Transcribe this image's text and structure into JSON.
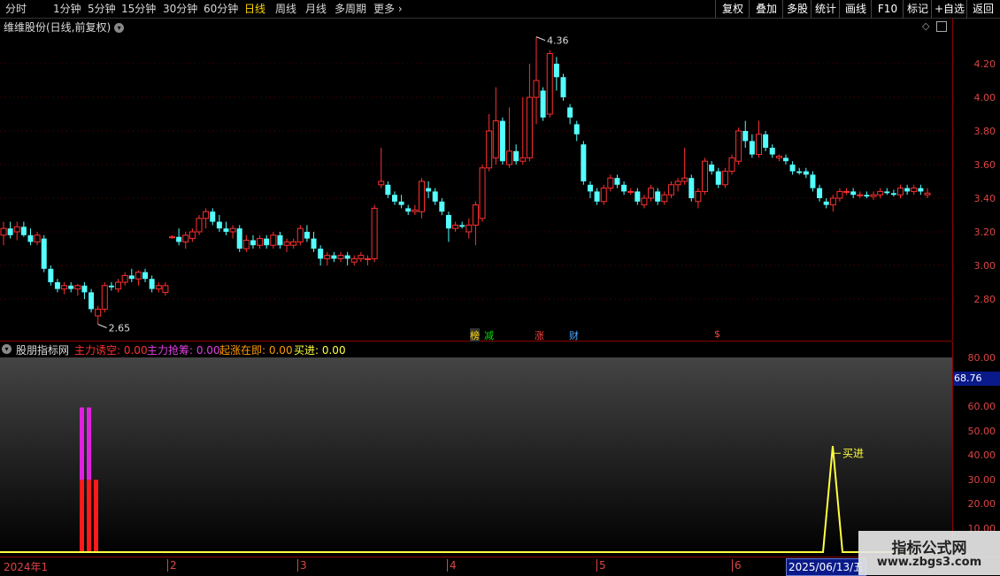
{
  "toolbar": {
    "periods": [
      "分时",
      "1分钟",
      "5分钟",
      "15分钟",
      "30分钟",
      "60分钟",
      "日线",
      "周线",
      "月线",
      "多周期",
      "更多"
    ],
    "active_period": "日线",
    "actions": [
      "复权",
      "叠加",
      "多股",
      "统计",
      "画线",
      "F10",
      "标记",
      "+自选",
      "返回"
    ]
  },
  "main": {
    "title": "维维股份(日线,前复权)",
    "y_labels": [
      "4.20",
      "4.00",
      "3.80",
      "3.60",
      "3.40",
      "3.20",
      "3.00",
      "2.80"
    ],
    "high_label": "4.36",
    "low_label": "2.65",
    "event_tags": [
      {
        "text": "榜",
        "color": "#ffd700"
      },
      {
        "text": "减",
        "color": "#00e000"
      },
      {
        "text": "涨",
        "color": "#ff4040"
      },
      {
        "text": "财",
        "color": "#4fa8ff"
      },
      {
        "text": "$",
        "color": "#ff4040"
      }
    ]
  },
  "indicator": {
    "name": "股朋指标网",
    "lines": [
      {
        "label": "主力诱空: 0.00",
        "color": "#ff3030"
      },
      {
        "label": "主力抢筹: 0.00",
        "color": "#e040e0"
      },
      {
        "label": "起涨在即: 0.00",
        "color": "#ff9a00"
      },
      {
        "label": "买进: 0.00",
        "color": "#ffff40"
      }
    ],
    "y_labels": [
      "80.00",
      "60.00",
      "50.00",
      "40.00",
      "30.00",
      "20.00",
      "10.00"
    ],
    "cursor_value": "68.76",
    "buy_label": "买进"
  },
  "dates": {
    "labels": [
      "2024年1",
      "2",
      "3",
      "4",
      "5",
      "6"
    ],
    "cursor_date": "2025/06/13/五"
  },
  "watermark": {
    "line1": "指标公式网",
    "line2": "www.zbgs3.com"
  },
  "colors": {
    "up": "#ff3030",
    "down": "#54ffff",
    "axis": "#d44",
    "grid": "#8b0000"
  },
  "chart_data": {
    "type": "candlestick",
    "ylim": [
      2.7,
      4.4
    ],
    "candles": [
      {
        "o": 3.18,
        "h": 3.26,
        "l": 3.12,
        "c": 3.22
      },
      {
        "o": 3.22,
        "h": 3.26,
        "l": 3.16,
        "c": 3.18
      },
      {
        "o": 3.2,
        "h": 3.26,
        "l": 3.15,
        "c": 3.23
      },
      {
        "o": 3.23,
        "h": 3.26,
        "l": 3.17,
        "c": 3.18
      },
      {
        "o": 3.18,
        "h": 3.22,
        "l": 3.12,
        "c": 3.14
      },
      {
        "o": 3.14,
        "h": 3.2,
        "l": 3.12,
        "c": 3.18
      },
      {
        "o": 3.16,
        "h": 3.18,
        "l": 2.96,
        "c": 2.98
      },
      {
        "o": 2.98,
        "h": 3.0,
        "l": 2.88,
        "c": 2.9
      },
      {
        "o": 2.9,
        "h": 2.92,
        "l": 2.84,
        "c": 2.86
      },
      {
        "o": 2.86,
        "h": 2.9,
        "l": 2.83,
        "c": 2.88
      },
      {
        "o": 2.88,
        "h": 2.9,
        "l": 2.84,
        "c": 2.86
      },
      {
        "o": 2.86,
        "h": 2.89,
        "l": 2.82,
        "c": 2.88
      },
      {
        "o": 2.88,
        "h": 2.9,
        "l": 2.8,
        "c": 2.84
      },
      {
        "o": 2.84,
        "h": 2.86,
        "l": 2.72,
        "c": 2.74
      },
      {
        "o": 2.7,
        "h": 2.76,
        "l": 2.65,
        "c": 2.74
      },
      {
        "o": 2.74,
        "h": 2.9,
        "l": 2.72,
        "c": 2.88
      },
      {
        "o": 2.88,
        "h": 2.9,
        "l": 2.85,
        "c": 2.87
      },
      {
        "o": 2.86,
        "h": 2.92,
        "l": 2.84,
        "c": 2.9
      },
      {
        "o": 2.9,
        "h": 2.96,
        "l": 2.88,
        "c": 2.94
      },
      {
        "o": 2.94,
        "h": 2.98,
        "l": 2.9,
        "c": 2.92
      },
      {
        "o": 2.92,
        "h": 2.97,
        "l": 2.88,
        "c": 2.96
      },
      {
        "o": 2.96,
        "h": 2.98,
        "l": 2.9,
        "c": 2.92
      },
      {
        "o": 2.92,
        "h": 2.94,
        "l": 2.84,
        "c": 2.86
      },
      {
        "o": 2.86,
        "h": 2.9,
        "l": 2.84,
        "c": 2.88
      },
      {
        "o": 2.84,
        "h": 2.9,
        "l": 2.82,
        "c": 2.88
      },
      {
        "o": 3.17,
        "h": 3.18,
        "l": 3.16,
        "c": 3.17
      },
      {
        "o": 3.17,
        "h": 3.22,
        "l": 3.12,
        "c": 3.14
      },
      {
        "o": 3.14,
        "h": 3.2,
        "l": 3.1,
        "c": 3.18
      },
      {
        "o": 3.16,
        "h": 3.22,
        "l": 3.14,
        "c": 3.2
      },
      {
        "o": 3.2,
        "h": 3.3,
        "l": 3.18,
        "c": 3.28
      },
      {
        "o": 3.28,
        "h": 3.34,
        "l": 3.22,
        "c": 3.32
      },
      {
        "o": 3.32,
        "h": 3.34,
        "l": 3.24,
        "c": 3.26
      },
      {
        "o": 3.26,
        "h": 3.3,
        "l": 3.2,
        "c": 3.22
      },
      {
        "o": 3.22,
        "h": 3.26,
        "l": 3.18,
        "c": 3.2
      },
      {
        "o": 3.2,
        "h": 3.24,
        "l": 3.16,
        "c": 3.22
      },
      {
        "o": 3.22,
        "h": 3.24,
        "l": 3.08,
        "c": 3.1
      },
      {
        "o": 3.1,
        "h": 3.18,
        "l": 3.08,
        "c": 3.15
      },
      {
        "o": 3.15,
        "h": 3.18,
        "l": 3.1,
        "c": 3.12
      },
      {
        "o": 3.12,
        "h": 3.18,
        "l": 3.1,
        "c": 3.16
      },
      {
        "o": 3.16,
        "h": 3.18,
        "l": 3.1,
        "c": 3.12
      },
      {
        "o": 3.12,
        "h": 3.2,
        "l": 3.1,
        "c": 3.18
      },
      {
        "o": 3.18,
        "h": 3.2,
        "l": 3.1,
        "c": 3.12
      },
      {
        "o": 3.12,
        "h": 3.16,
        "l": 3.08,
        "c": 3.14
      },
      {
        "o": 3.12,
        "h": 3.16,
        "l": 3.1,
        "c": 3.14
      },
      {
        "o": 3.14,
        "h": 3.24,
        "l": 3.12,
        "c": 3.22
      },
      {
        "o": 3.2,
        "h": 3.24,
        "l": 3.14,
        "c": 3.16
      },
      {
        "o": 3.16,
        "h": 3.2,
        "l": 3.08,
        "c": 3.1
      },
      {
        "o": 3.1,
        "h": 3.12,
        "l": 3.0,
        "c": 3.04
      },
      {
        "o": 3.04,
        "h": 3.08,
        "l": 3.0,
        "c": 3.06
      },
      {
        "o": 3.06,
        "h": 3.08,
        "l": 3.02,
        "c": 3.04
      },
      {
        "o": 3.04,
        "h": 3.08,
        "l": 3.02,
        "c": 3.06
      },
      {
        "o": 3.06,
        "h": 3.08,
        "l": 3.0,
        "c": 3.04
      },
      {
        "o": 3.02,
        "h": 3.06,
        "l": 3.0,
        "c": 3.04
      },
      {
        "o": 3.04,
        "h": 3.08,
        "l": 3.02,
        "c": 3.06
      },
      {
        "o": 3.04,
        "h": 3.06,
        "l": 3.0,
        "c": 3.04
      },
      {
        "o": 3.04,
        "h": 3.36,
        "l": 3.02,
        "c": 3.34
      },
      {
        "o": 3.48,
        "h": 3.7,
        "l": 3.46,
        "c": 3.5
      },
      {
        "o": 3.48,
        "h": 3.5,
        "l": 3.4,
        "c": 3.42
      },
      {
        "o": 3.42,
        "h": 3.44,
        "l": 3.36,
        "c": 3.38
      },
      {
        "o": 3.38,
        "h": 3.42,
        "l": 3.34,
        "c": 3.36
      },
      {
        "o": 3.34,
        "h": 3.36,
        "l": 3.3,
        "c": 3.32
      },
      {
        "o": 3.32,
        "h": 3.36,
        "l": 3.3,
        "c": 3.33
      },
      {
        "o": 3.32,
        "h": 3.52,
        "l": 3.28,
        "c": 3.5
      },
      {
        "o": 3.46,
        "h": 3.5,
        "l": 3.4,
        "c": 3.44
      },
      {
        "o": 3.44,
        "h": 3.46,
        "l": 3.36,
        "c": 3.38
      },
      {
        "o": 3.38,
        "h": 3.4,
        "l": 3.3,
        "c": 3.32
      },
      {
        "o": 3.3,
        "h": 3.32,
        "l": 3.14,
        "c": 3.22
      },
      {
        "o": 3.22,
        "h": 3.26,
        "l": 3.2,
        "c": 3.24
      },
      {
        "o": 3.24,
        "h": 3.26,
        "l": 3.22,
        "c": 3.23
      },
      {
        "o": 3.2,
        "h": 3.28,
        "l": 3.16,
        "c": 3.24
      },
      {
        "o": 3.24,
        "h": 3.38,
        "l": 3.12,
        "c": 3.36
      },
      {
        "o": 3.28,
        "h": 3.6,
        "l": 3.26,
        "c": 3.58
      },
      {
        "o": 3.58,
        "h": 3.9,
        "l": 3.56,
        "c": 3.8
      },
      {
        "o": 3.64,
        "h": 4.06,
        "l": 3.6,
        "c": 3.86
      },
      {
        "o": 3.86,
        "h": 3.88,
        "l": 3.6,
        "c": 3.62
      },
      {
        "o": 3.6,
        "h": 3.94,
        "l": 3.58,
        "c": 3.68
      },
      {
        "o": 3.68,
        "h": 3.72,
        "l": 3.6,
        "c": 3.62
      },
      {
        "o": 3.62,
        "h": 4.0,
        "l": 3.6,
        "c": 3.64
      },
      {
        "o": 3.64,
        "h": 4.2,
        "l": 3.62,
        "c": 4.0
      },
      {
        "o": 4.0,
        "h": 4.36,
        "l": 3.84,
        "c": 4.1
      },
      {
        "o": 4.04,
        "h": 4.06,
        "l": 3.86,
        "c": 3.88
      },
      {
        "o": 3.9,
        "h": 4.28,
        "l": 3.88,
        "c": 4.26
      },
      {
        "o": 4.2,
        "h": 4.24,
        "l": 4.04,
        "c": 4.12
      },
      {
        "o": 4.12,
        "h": 4.14,
        "l": 3.98,
        "c": 4.0
      },
      {
        "o": 3.94,
        "h": 3.96,
        "l": 3.84,
        "c": 3.88
      },
      {
        "o": 3.84,
        "h": 3.86,
        "l": 3.74,
        "c": 3.78
      },
      {
        "o": 3.72,
        "h": 3.74,
        "l": 3.48,
        "c": 3.5
      },
      {
        "o": 3.48,
        "h": 3.5,
        "l": 3.4,
        "c": 3.44
      },
      {
        "o": 3.44,
        "h": 3.46,
        "l": 3.36,
        "c": 3.38
      },
      {
        "o": 3.38,
        "h": 3.48,
        "l": 3.36,
        "c": 3.46
      },
      {
        "o": 3.46,
        "h": 3.54,
        "l": 3.44,
        "c": 3.52
      },
      {
        "o": 3.52,
        "h": 3.54,
        "l": 3.46,
        "c": 3.48
      },
      {
        "o": 3.48,
        "h": 3.5,
        "l": 3.42,
        "c": 3.44
      },
      {
        "o": 3.44,
        "h": 3.46,
        "l": 3.42,
        "c": 3.44
      },
      {
        "o": 3.44,
        "h": 3.46,
        "l": 3.36,
        "c": 3.38
      },
      {
        "o": 3.36,
        "h": 3.42,
        "l": 3.34,
        "c": 3.4
      },
      {
        "o": 3.4,
        "h": 3.48,
        "l": 3.38,
        "c": 3.46
      },
      {
        "o": 3.44,
        "h": 3.46,
        "l": 3.36,
        "c": 3.38
      },
      {
        "o": 3.38,
        "h": 3.44,
        "l": 3.36,
        "c": 3.42
      },
      {
        "o": 3.42,
        "h": 3.5,
        "l": 3.4,
        "c": 3.48
      },
      {
        "o": 3.48,
        "h": 3.52,
        "l": 3.44,
        "c": 3.5
      },
      {
        "o": 3.5,
        "h": 3.7,
        "l": 3.48,
        "c": 3.52
      },
      {
        "o": 3.52,
        "h": 3.54,
        "l": 3.38,
        "c": 3.4
      },
      {
        "o": 3.38,
        "h": 3.46,
        "l": 3.34,
        "c": 3.44
      },
      {
        "o": 3.44,
        "h": 3.64,
        "l": 3.42,
        "c": 3.62
      },
      {
        "o": 3.6,
        "h": 3.62,
        "l": 3.54,
        "c": 3.56
      },
      {
        "o": 3.56,
        "h": 3.58,
        "l": 3.46,
        "c": 3.48
      },
      {
        "o": 3.48,
        "h": 3.58,
        "l": 3.46,
        "c": 3.56
      },
      {
        "o": 3.56,
        "h": 3.66,
        "l": 3.54,
        "c": 3.64
      },
      {
        "o": 3.62,
        "h": 3.82,
        "l": 3.6,
        "c": 3.8
      },
      {
        "o": 3.8,
        "h": 3.86,
        "l": 3.7,
        "c": 3.74
      },
      {
        "o": 3.74,
        "h": 3.78,
        "l": 3.64,
        "c": 3.66
      },
      {
        "o": 3.66,
        "h": 3.86,
        "l": 3.64,
        "c": 3.78
      },
      {
        "o": 3.78,
        "h": 3.8,
        "l": 3.68,
        "c": 3.7
      },
      {
        "o": 3.7,
        "h": 3.72,
        "l": 3.64,
        "c": 3.66
      },
      {
        "o": 3.64,
        "h": 3.66,
        "l": 3.62,
        "c": 3.65
      },
      {
        "o": 3.64,
        "h": 3.66,
        "l": 3.6,
        "c": 3.62
      },
      {
        "o": 3.6,
        "h": 3.62,
        "l": 3.54,
        "c": 3.56
      },
      {
        "o": 3.56,
        "h": 3.58,
        "l": 3.54,
        "c": 3.55
      },
      {
        "o": 3.56,
        "h": 3.58,
        "l": 3.52,
        "c": 3.54
      },
      {
        "o": 3.54,
        "h": 3.56,
        "l": 3.44,
        "c": 3.46
      },
      {
        "o": 3.46,
        "h": 3.48,
        "l": 3.38,
        "c": 3.4
      },
      {
        "o": 3.38,
        "h": 3.4,
        "l": 3.34,
        "c": 3.36
      },
      {
        "o": 3.36,
        "h": 3.42,
        "l": 3.32,
        "c": 3.4
      },
      {
        "o": 3.4,
        "h": 3.46,
        "l": 3.38,
        "c": 3.44
      },
      {
        "o": 3.44,
        "h": 3.46,
        "l": 3.42,
        "c": 3.44
      },
      {
        "o": 3.44,
        "h": 3.46,
        "l": 3.4,
        "c": 3.42
      },
      {
        "o": 3.42,
        "h": 3.44,
        "l": 3.4,
        "c": 3.42
      },
      {
        "o": 3.42,
        "h": 3.44,
        "l": 3.4,
        "c": 3.41
      },
      {
        "o": 3.41,
        "h": 3.44,
        "l": 3.39,
        "c": 3.42
      },
      {
        "o": 3.42,
        "h": 3.46,
        "l": 3.4,
        "c": 3.44
      },
      {
        "o": 3.44,
        "h": 3.46,
        "l": 3.42,
        "c": 3.43
      },
      {
        "o": 3.43,
        "h": 3.45,
        "l": 3.41,
        "c": 3.42
      },
      {
        "o": 3.42,
        "h": 3.48,
        "l": 3.4,
        "c": 3.46
      },
      {
        "o": 3.46,
        "h": 3.48,
        "l": 3.42,
        "c": 3.44
      },
      {
        "o": 3.44,
        "h": 3.48,
        "l": 3.42,
        "c": 3.46
      },
      {
        "o": 3.46,
        "h": 3.48,
        "l": 3.42,
        "c": 3.44
      },
      {
        "o": 3.42,
        "h": 3.46,
        "l": 3.4,
        "c": 3.43
      }
    ]
  }
}
